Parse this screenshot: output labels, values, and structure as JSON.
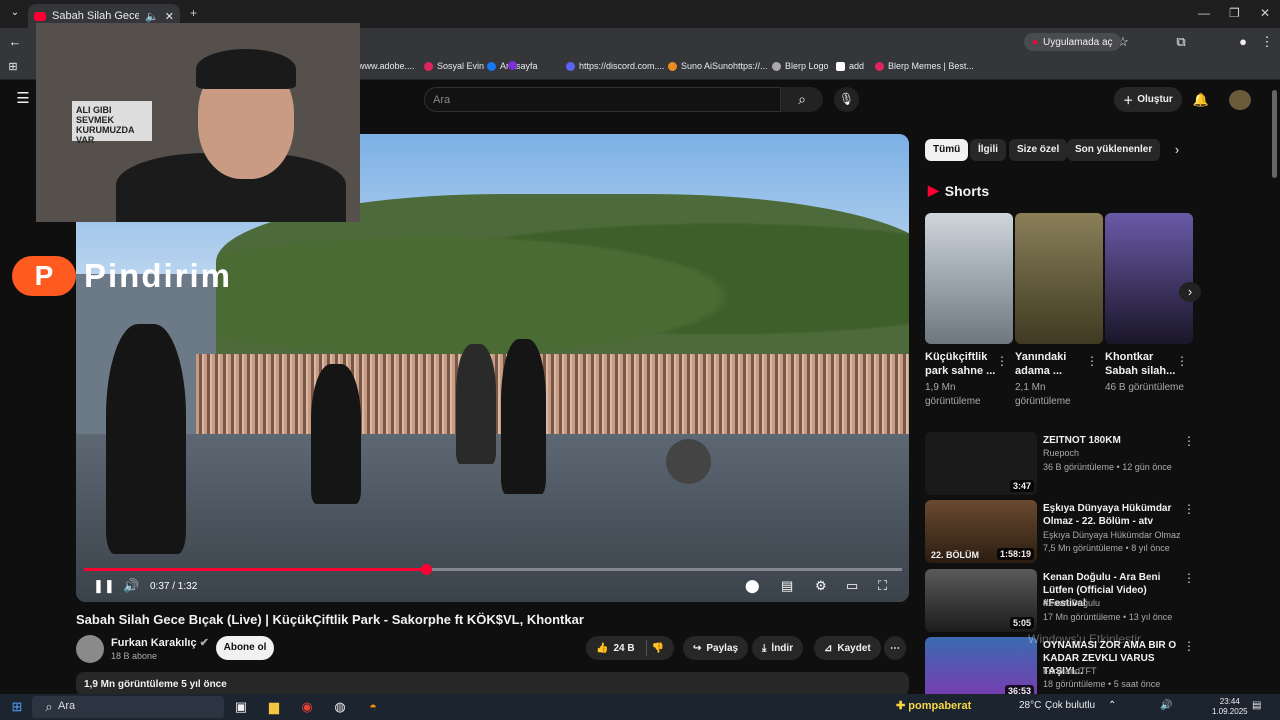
{
  "browser": {
    "tab_title": "Sabah Silah Gece Bıçak (Live)",
    "app_pill": "Uygulamada aç",
    "bookmarks": [
      "www.adobe....",
      "Sosyal Evin",
      "Anasayfa",
      "https://discord.com....",
      "Suno AiSunohttps://...",
      "Blerp Logo",
      "add",
      "Blerp Memes | Best..."
    ]
  },
  "youtube": {
    "search_placeholder": "Ara",
    "create_label": "Oluştur"
  },
  "overlay": {
    "banner": "ALI GIBI SEVMEK KURUMUZDA VAR",
    "brand_letter": "P",
    "brand_word": "Pindirim"
  },
  "player": {
    "time": "0:37 / 1:32",
    "progress_fraction": 0.415
  },
  "video": {
    "title": "Sabah Silah Gece Bıçak (Live) | KüçükÇiftlik Park - Sakorphe ft KÖK$VL, Khontkar",
    "channel": "Furkan Karakılıç",
    "subscribers": "18 B abone",
    "subscribe": "Abone ol",
    "likes": "24 B",
    "share": "Paylaş",
    "download": "İndir",
    "save": "Kaydet",
    "views_date": "1,9 Mn görüntüleme  5 yıl önce"
  },
  "chips": [
    "Tümü",
    "İlgili",
    "Size özel",
    "Son yüklenenler"
  ],
  "shorts": {
    "heading": "Shorts",
    "items": [
      {
        "title": "Küçükçiftlik park sahne ...",
        "views": "1,9 Mn görüntüleme"
      },
      {
        "title": "Yanındaki adama ...",
        "views": "2,1 Mn görüntüleme"
      },
      {
        "title": "Khontkar Sabah silah...",
        "views": "46 B görüntüleme"
      }
    ]
  },
  "recommended": [
    {
      "title": "ZEITNOT 180KM",
      "channel": "Ruepoch",
      "meta": "36 B görüntüleme • 12 gün önce",
      "duration": "3:47"
    },
    {
      "title": "Eşkıya Dünyaya Hükümdar Olmaz - 22. Bölüm - atv",
      "channel": "Eşkıya Dünyaya Hükümdar Olmaz",
      "meta": "7,5 Mn görüntüleme • 8 yıl önce",
      "duration": "1:58:19",
      "badge": "22. BÖLÜM"
    },
    {
      "title": "Kenan Doğulu - Ara Beni Lütfen (Official Video) #Festival",
      "channel": "Kenan Doğulu",
      "meta": "17 Mn görüntüleme • 13 yıl önce",
      "duration": "5:05"
    },
    {
      "title": "OYNAMASI ZOR AMA BIR O KADAR ZEVKLI VARUS TAŞIYI...",
      "channel": "FurkilandTFT",
      "meta": "18 görüntüleme • 5 saat önce",
      "duration": "36:53"
    }
  ],
  "watermark": "Windows'u Etkinleştir",
  "taskbar": {
    "search": "Ara",
    "user": "pompaberat",
    "weather": "28°C",
    "weather_text": "Çok bulutlu",
    "time": "23:44",
    "date": "1.09.2025"
  }
}
